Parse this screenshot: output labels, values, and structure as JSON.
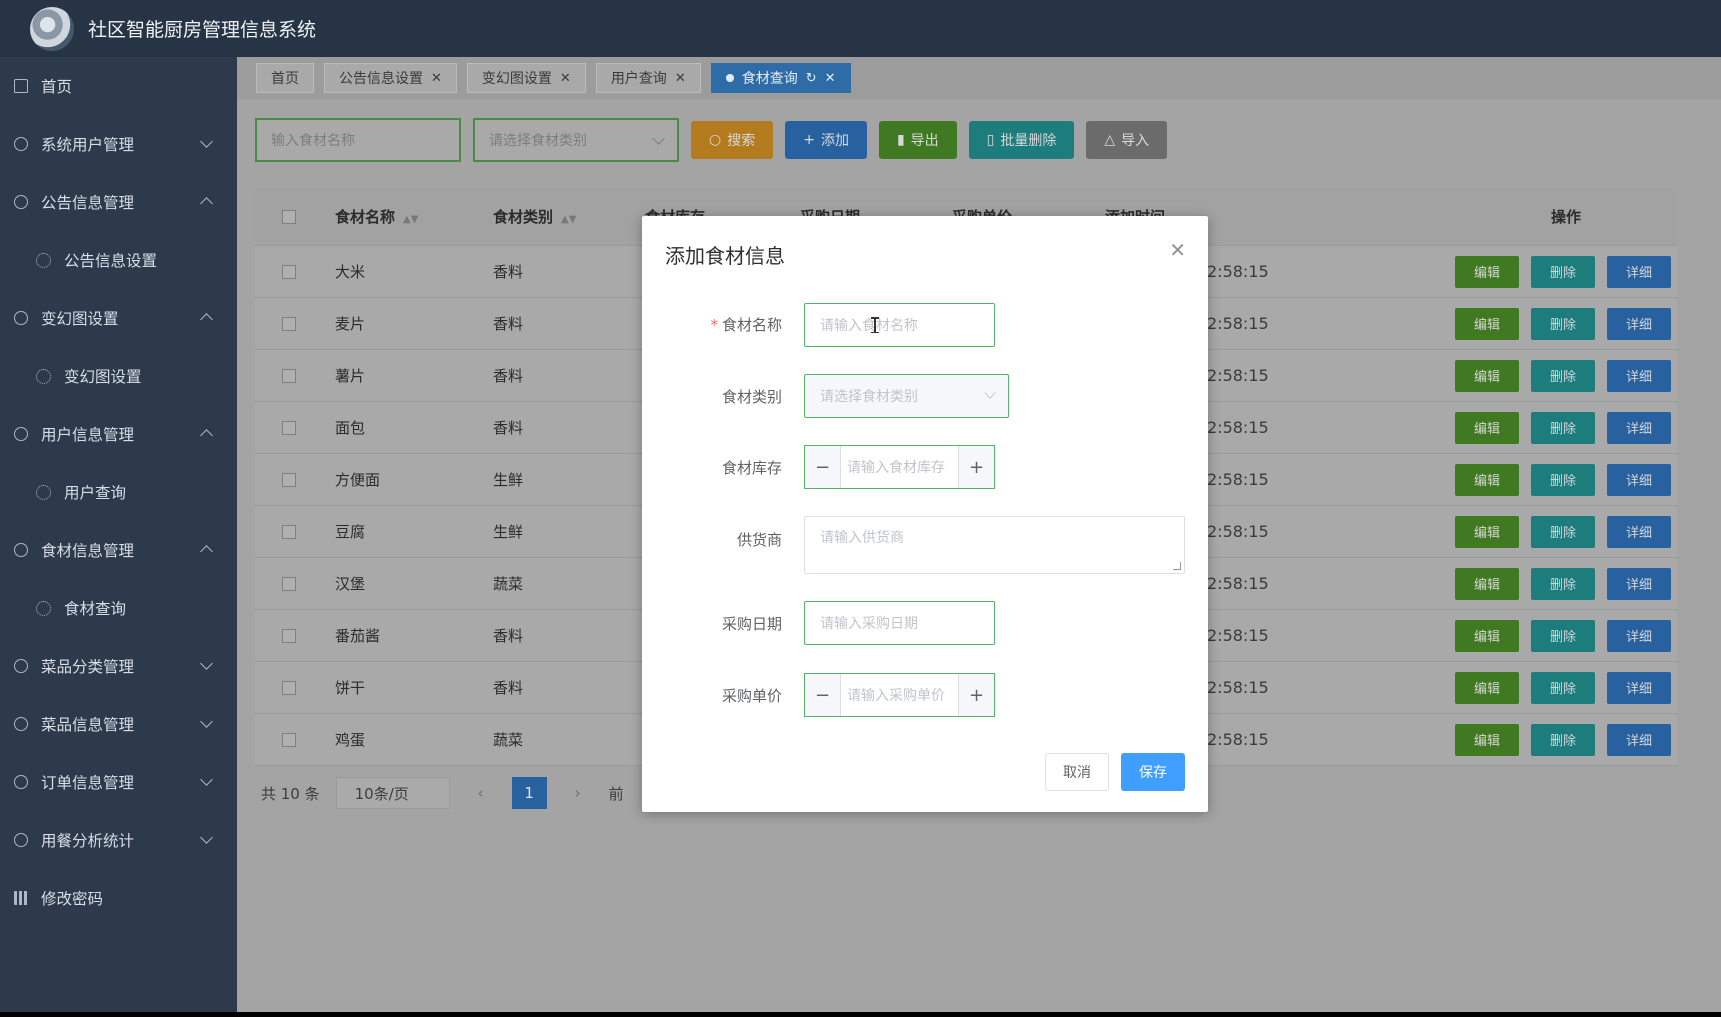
{
  "app": {
    "title": "社区智能厨房管理信息系统"
  },
  "sidebar": {
    "items": [
      {
        "label": "首页",
        "icon": "home-icon"
      },
      {
        "label": "系统用户管理",
        "icon": "circle-icon",
        "expanded": false
      },
      {
        "label": "公告信息管理",
        "icon": "circle-icon",
        "expanded": true
      },
      {
        "label": "公告信息设置",
        "icon": "gear-icon",
        "sub": true
      },
      {
        "label": "变幻图设置",
        "icon": "circle-icon",
        "expanded": true
      },
      {
        "label": "变幻图设置",
        "icon": "gear-icon",
        "sub": true
      },
      {
        "label": "用户信息管理",
        "icon": "circle-icon",
        "expanded": true
      },
      {
        "label": "用户查询",
        "icon": "gear-icon",
        "sub": true
      },
      {
        "label": "食材信息管理",
        "icon": "circle-icon",
        "expanded": true
      },
      {
        "label": "食材查询",
        "icon": "gear-icon",
        "sub": true
      },
      {
        "label": "菜品分类管理",
        "icon": "circle-icon",
        "expanded": false
      },
      {
        "label": "菜品信息管理",
        "icon": "circle-icon",
        "expanded": false
      },
      {
        "label": "订单信息管理",
        "icon": "circle-icon",
        "expanded": false
      },
      {
        "label": "用餐分析统计",
        "icon": "circle-icon",
        "expanded": false
      },
      {
        "label": "修改密码",
        "icon": "grid-icon"
      }
    ]
  },
  "tabs": [
    {
      "label": "首页",
      "closable": false,
      "active": false
    },
    {
      "label": "公告信息设置",
      "closable": true,
      "active": false
    },
    {
      "label": "变幻图设置",
      "closable": true,
      "active": false
    },
    {
      "label": "用户查询",
      "closable": true,
      "active": false
    },
    {
      "label": "食材查询",
      "closable": true,
      "active": true
    }
  ],
  "toolbar": {
    "name_placeholder": "输入食材名称",
    "type_placeholder": "请选择食材类别",
    "search": "搜索",
    "add": "添加",
    "export": "导出",
    "batch_delete": "批量删除",
    "import": "导入"
  },
  "table": {
    "headers": {
      "name": "食材名称",
      "type": "食材类别",
      "stock": "食材库存",
      "date": "采购日期",
      "price": "采购单价",
      "added": "添加时间",
      "ops": "操作"
    },
    "rows": [
      {
        "name": "大米",
        "type": "香料",
        "time": "2:58:15"
      },
      {
        "name": "麦片",
        "type": "香料",
        "time": "2:58:15"
      },
      {
        "name": "薯片",
        "type": "香料",
        "time": "2:58:15"
      },
      {
        "name": "面包",
        "type": "香料",
        "time": "2:58:15"
      },
      {
        "name": "方便面",
        "type": "生鲜",
        "time": "2:58:15"
      },
      {
        "name": "豆腐",
        "type": "生鲜",
        "time": "2:58:15"
      },
      {
        "name": "汉堡",
        "type": "蔬菜",
        "time": "2:58:15"
      },
      {
        "name": "番茄酱",
        "type": "香料",
        "time": "2:58:15"
      },
      {
        "name": "饼干",
        "type": "香料",
        "time": "2:58:15"
      },
      {
        "name": "鸡蛋",
        "type": "蔬菜",
        "time": "2:58:15"
      }
    ],
    "op_labels": {
      "edit": "编辑",
      "delete": "删除",
      "detail": "详细"
    }
  },
  "pager": {
    "total": "共 10 条",
    "size": "10条/页",
    "current": "1",
    "goto": "前"
  },
  "modal": {
    "title": "添加食材信息",
    "fields": {
      "name_label": "食材名称",
      "name_placeholder": "请输入食材名称",
      "type_label": "食材类别",
      "type_placeholder": "请选择食材类别",
      "stock_label": "食材库存",
      "stock_placeholder": "请输入食材库存",
      "supplier_label": "供货商",
      "supplier_placeholder": "请输入供货商",
      "date_label": "采购日期",
      "date_placeholder": "请输入采购日期",
      "price_label": "采购单价",
      "price_placeholder": "请输入采购单价"
    },
    "cancel": "取消",
    "save": "保存"
  },
  "colors": {
    "primary": "#409eff",
    "sidebar": "#2d3a4b",
    "header": "#263445",
    "focus_border": "#54b36b",
    "required": "#f56c6c"
  }
}
